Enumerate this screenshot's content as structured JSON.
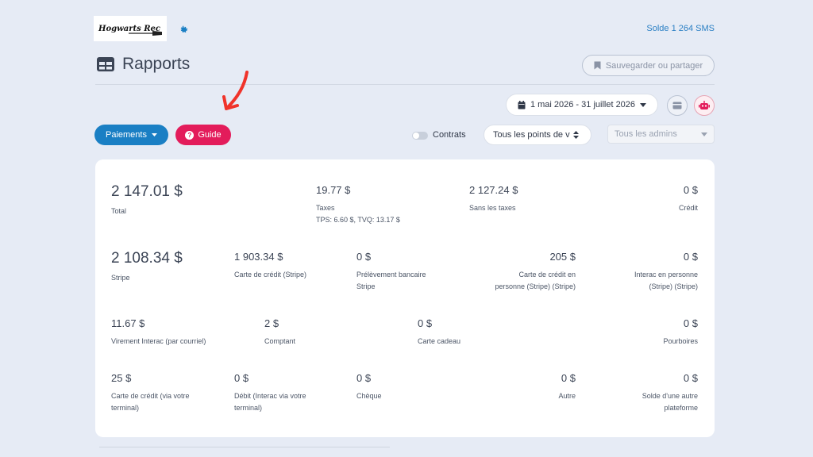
{
  "header": {
    "logo_text": "Hogwarts Rec",
    "solde_label": "Solde",
    "solde_value": "1 264 SMS"
  },
  "page": {
    "title": "Rapports",
    "save_label": "Sauvegarder ou partager"
  },
  "toolbar": {
    "date_range": "1 mai 2026 - 31 juillet 2026",
    "paiements_label": "Paiements",
    "guide_label": "Guide",
    "contrats_label": "Contrats",
    "points_select": "Tous les points de v",
    "admins_placeholder": "Tous les admins"
  },
  "stats": {
    "total": {
      "value": "2 147.01 $",
      "label": "Total"
    },
    "taxes": {
      "value": "19.77 $",
      "label": "Taxes",
      "sub": "TPS: 6.60 $, TVQ: 13.17 $"
    },
    "sans_taxes": {
      "value": "2 127.24 $",
      "label": "Sans les taxes"
    },
    "credit": {
      "value": "0 $",
      "label": "Crédit"
    },
    "stripe": {
      "value": "2 108.34 $",
      "label": "Stripe"
    },
    "cc_stripe": {
      "value": "1 903.34 $",
      "label": "Carte de crédit (Stripe)"
    },
    "prelevement": {
      "value": "0 $",
      "label1": "Prélèvement bancaire",
      "label2": "Stripe"
    },
    "cc_personne": {
      "value": "205 $",
      "label1": "Carte de crédit en",
      "label2": "personne (Stripe) (Stripe)"
    },
    "interac_personne": {
      "value": "0 $",
      "label1": "Interac en personne",
      "label2": "(Stripe) (Stripe)"
    },
    "virement": {
      "value": "11.67 $",
      "label": "Virement Interac (par courriel)"
    },
    "comptant": {
      "value": "2 $",
      "label": "Comptant"
    },
    "carte_cadeau": {
      "value": "0 $",
      "label": "Carte cadeau"
    },
    "pourboires": {
      "value": "0 $",
      "label": "Pourboires"
    },
    "cc_terminal": {
      "value": "25 $",
      "label1": "Carte de crédit (via votre",
      "label2": "terminal)"
    },
    "debit": {
      "value": "0 $",
      "label1": "Débit (Interac via votre",
      "label2": "terminal)"
    },
    "cheque": {
      "value": "0 $",
      "label": "Chèque"
    },
    "autre": {
      "value": "0 $",
      "label": "Autre"
    },
    "autre_plateforme": {
      "value": "0 $",
      "label1": "Solde d'une autre",
      "label2": "plateforme"
    }
  },
  "colors": {
    "background": "#e6ebf5",
    "primary": "#1a7fc4",
    "danger": "#e31c5b",
    "annotation_arrow": "#f0332a"
  },
  "icons": [
    "gear-icon",
    "table-icon",
    "bookmark-icon",
    "calendar-icon",
    "caret-down-icon",
    "question-icon",
    "sort-icon",
    "card-icon",
    "robot-icon",
    "annotation-arrow"
  ]
}
